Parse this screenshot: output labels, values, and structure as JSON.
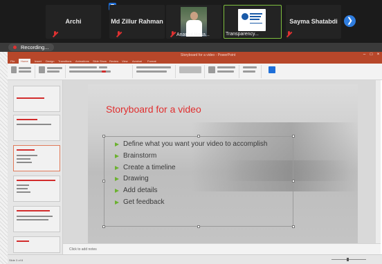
{
  "meeting": {
    "participants": [
      {
        "name": "Archi"
      },
      {
        "name": "Md Zillur Rahman"
      },
      {
        "name": "Anamul Hasan",
        "label": "Anamul Hasa..."
      },
      {
        "name": "Transparency...",
        "label": "Transparency..."
      },
      {
        "name": "Sayma Shatabdi"
      }
    ]
  },
  "recording": {
    "label": "Recording..."
  },
  "powerpoint": {
    "title": "Storyboard for a video - PowerPoint",
    "tabs": [
      "File",
      "Home",
      "Insert",
      "Design",
      "Transitions",
      "Animations",
      "Slide Show",
      "Review",
      "View",
      "Acrobat",
      "Format"
    ],
    "slide": {
      "title": "Storyboard for a video",
      "bullets": [
        "Define what you want your video to accomplish",
        "Brainstorm",
        "Create a timeline",
        "Drawing",
        "Add details",
        "Get feedback"
      ]
    },
    "notes_placeholder": "Click to add notes",
    "status": "Slide 3 of 8"
  },
  "colors": {
    "ppt_red": "#b7472a",
    "title_red": "#e02f2f",
    "bullet_green": "#6bb12f",
    "meet_accent": "#2f7ddf"
  }
}
